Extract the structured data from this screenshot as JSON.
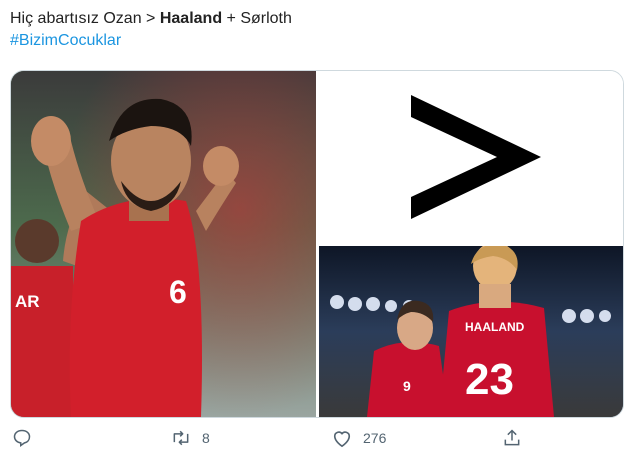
{
  "tweet": {
    "text_prefix": "Hiç abartısız Ozan > ",
    "text_bold": "Haaland",
    "text_suffix": " + Sørloth",
    "hashtag": "#BizimCocuklar"
  },
  "media": {
    "left_photo": {
      "jersey_number": "6",
      "background_player_text": "AR"
    },
    "top_right": {
      "symbol": ">"
    },
    "bottom_right_photo": {
      "back_name": "HAALAND",
      "back_number": "23",
      "front_number": "9"
    }
  },
  "actions": {
    "reply_count": "",
    "retweet_count": "8",
    "like_count": "276"
  },
  "colors": {
    "hashtag": "#1b95e0",
    "action_gray": "#536471",
    "turkey_red": "#d21f2b",
    "norway_red": "#c8102e"
  }
}
